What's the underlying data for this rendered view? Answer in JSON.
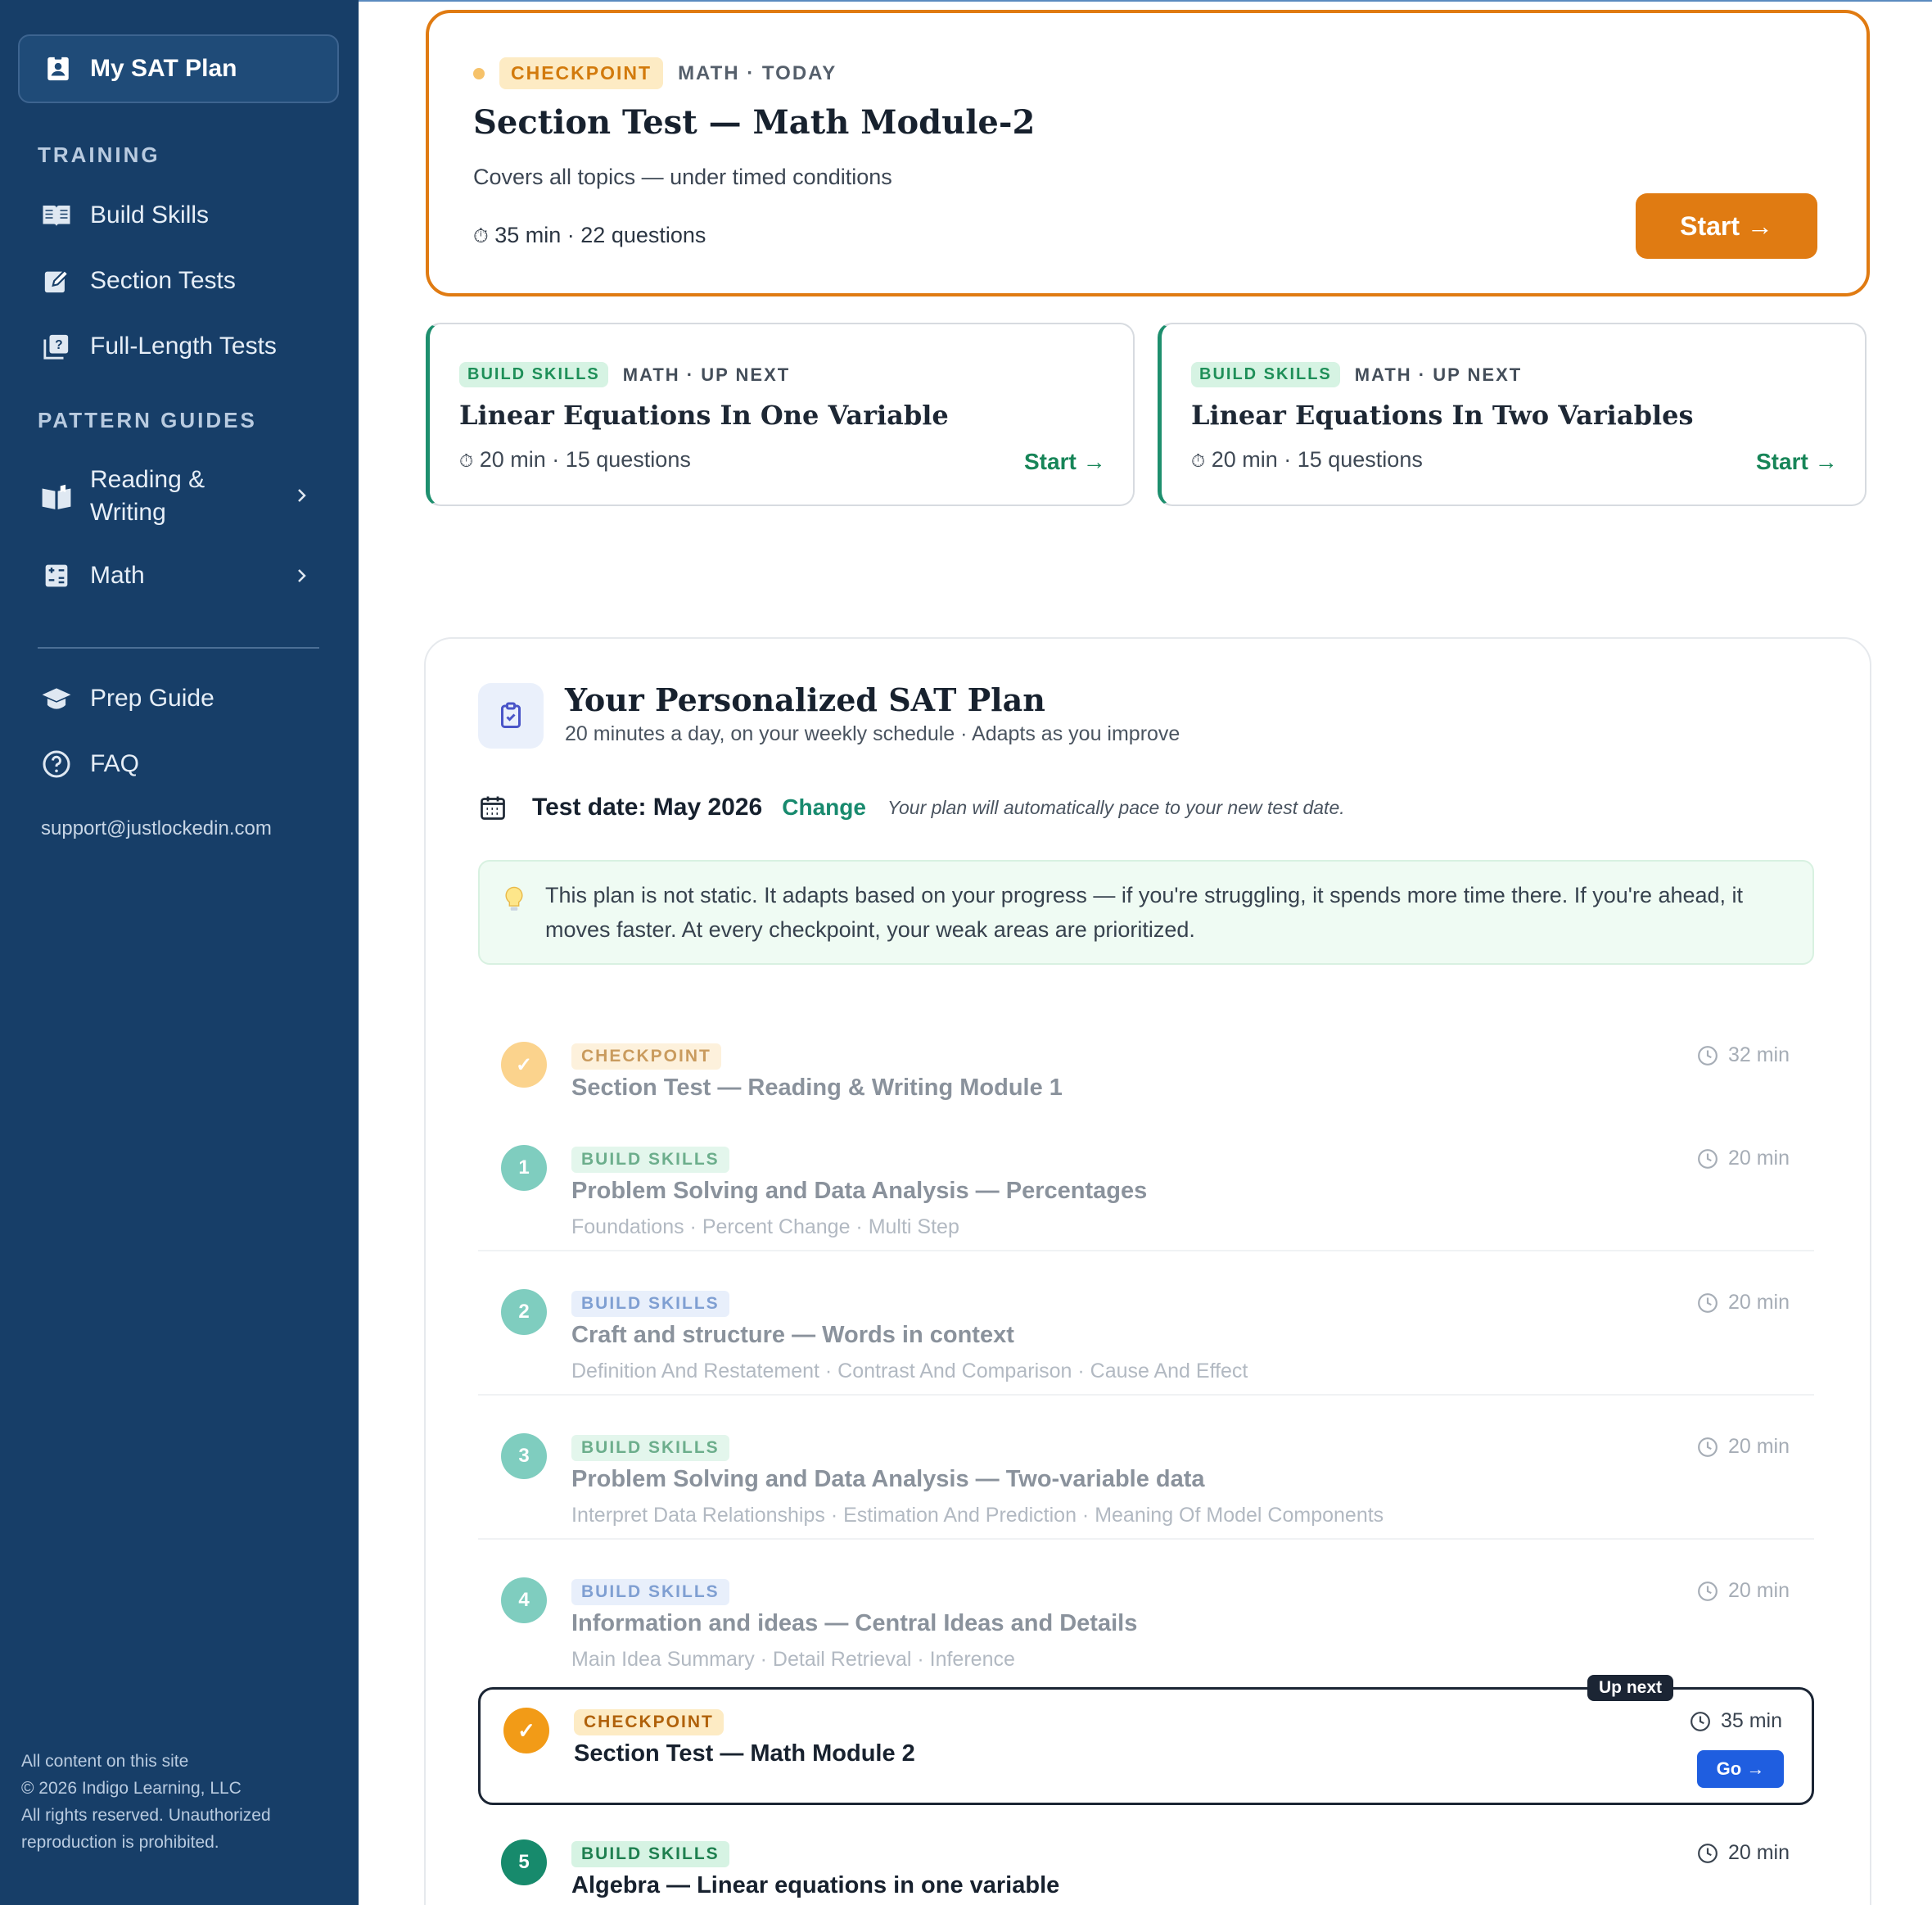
{
  "sidebar": {
    "my_plan": "My SAT Plan",
    "training_heading": "TRAINING",
    "training_items": [
      {
        "label": "Build Skills",
        "icon": "book-icon"
      },
      {
        "label": "Section Tests",
        "icon": "pencil-square-icon"
      },
      {
        "label": "Full-Length Tests",
        "icon": "quiz-icon"
      }
    ],
    "pattern_heading": "PATTERN GUIDES",
    "pattern_items": [
      {
        "label_line1": "Reading &",
        "label_line2": "Writing",
        "icon": "open-book-icon"
      },
      {
        "label": "Math",
        "icon": "calculator-icon"
      }
    ],
    "extra_items": [
      {
        "label": "Prep Guide",
        "icon": "graduation-cap-icon"
      },
      {
        "label": "FAQ",
        "icon": "help-circle-icon"
      }
    ],
    "email": "support@justlockedin.com",
    "footer": [
      "All content on this site",
      "© 2026 Indigo Learning, LLC",
      "All rights reserved. Unauthorized",
      "reproduction is prohibited."
    ]
  },
  "today": {
    "tag": "CHECKPOINT",
    "context": "MATH · TODAY",
    "title": "Section Test — Math Module-2",
    "desc": "Covers all topics — under timed conditions",
    "meta": "35 min · 22 questions",
    "start": "Start →"
  },
  "next_cards": [
    {
      "tag": "BUILD SKILLS",
      "context": "MATH · UP NEXT",
      "title": "Linear Equations In One Variable",
      "meta": "20 min · 15 questions",
      "start": "Start →"
    },
    {
      "tag": "BUILD SKILLS",
      "context": "MATH · UP NEXT",
      "title": "Linear Equations In Two Variables",
      "meta": "20 min · 15 questions",
      "start": "Start →"
    }
  ],
  "plan": {
    "title": "Your Personalized SAT Plan",
    "subtitle": "20 minutes a day, on your weekly schedule · Adapts as you improve",
    "test_date": "Test date: May 2026",
    "change": "Change",
    "note": "Your plan will automatically pace to your new test date.",
    "callout": "This plan is not static. It adapts based on your progress — if you're struggling, it spends more time there. If you're ahead, it moves faster. At every checkpoint, your weak areas are prioritized.",
    "rows": [
      {
        "badge": "✓",
        "tag": "CHECKPOINT",
        "title": "Section Test — Reading & Writing Module 1",
        "topics": "",
        "duration": "32 min"
      },
      {
        "badge": "1",
        "tag": "BUILD SKILLS",
        "title": "Problem Solving and Data Analysis — Percentages",
        "topics": "Foundations  ·  Percent Change  ·  Multi Step",
        "duration": "20 min"
      },
      {
        "badge": "2",
        "tag": "BUILD SKILLS",
        "title": "Craft and structure — Words in context",
        "topics": "Definition And Restatement  ·  Contrast And Comparison  ·  Cause And Effect",
        "duration": "20 min"
      },
      {
        "badge": "3",
        "tag": "BUILD SKILLS",
        "title": "Problem Solving and Data Analysis — Two-variable data",
        "topics": "Interpret Data Relationships  ·  Estimation And Prediction  ·  Meaning Of Model Components",
        "duration": "20 min"
      },
      {
        "badge": "4",
        "tag": "BUILD SKILLS",
        "title": "Information and ideas — Central Ideas and Details",
        "topics": "Main Idea Summary  ·  Detail Retrieval  ·  Inference",
        "duration": "20 min"
      }
    ],
    "current": {
      "badge": "✓",
      "upnext": "Up next",
      "tag": "CHECKPOINT",
      "title": "Section Test — Math Module 2",
      "duration": "35 min",
      "go": "Go →"
    },
    "after": {
      "badge": "5",
      "tag": "BUILD SKILLS",
      "title": "Algebra — Linear equations in one variable",
      "duration": "20 min"
    }
  },
  "colors": {
    "sidebar": "#173e68",
    "accent_orange": "#e07b12",
    "accent_green": "#178558",
    "go_blue": "#1f5ee0"
  }
}
